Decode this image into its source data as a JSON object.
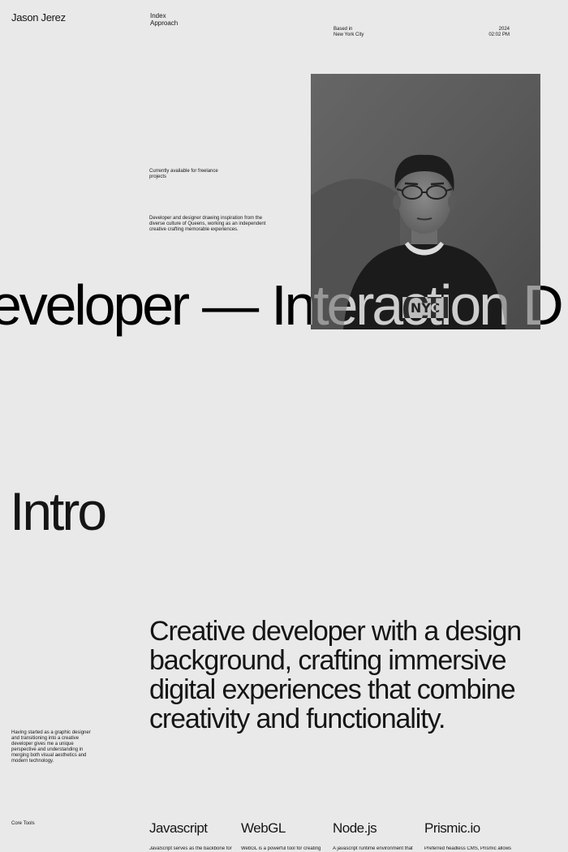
{
  "header": {
    "brand": "Jason Jerez",
    "nav": [
      "Index",
      "Approach"
    ],
    "location_label": "Based in",
    "location": "New York City",
    "year": "2024",
    "time": "02:02 PM"
  },
  "hero": {
    "availability": "Currently available for freelance projects",
    "description": "Developer and designer drawing inspiration from the diverse culture of Queens, working as an independent creative crafting memorable experiences.",
    "marquee": "eveloper — Interaction D",
    "shirt_text": "NYC"
  },
  "intro": {
    "title": "Intro",
    "statement": "Creative developer with a design background, crafting immersive digital experiences that combine creativity and functionality.",
    "bio": "Having started as a graphic designer and transitioning into a creative developer gives me a unique perspective and understanding in merging both visual aesthetics and modern technology."
  },
  "tools": {
    "label": "Core Tools",
    "items": [
      {
        "name": "Javascript",
        "desc": "JavaScript serves as the backbone for"
      },
      {
        "name": "WebGL",
        "desc": "WebGL is a powerful tool for creating"
      },
      {
        "name": "Node.js",
        "desc": "A javascript runtime environment that"
      },
      {
        "name": "Prismic.io",
        "desc": "Preferred headless CMS, Prismic allows"
      }
    ]
  },
  "colors": {
    "background": "#e9e9e9",
    "text": "#151515",
    "photo_background": "#5d5d5d"
  }
}
